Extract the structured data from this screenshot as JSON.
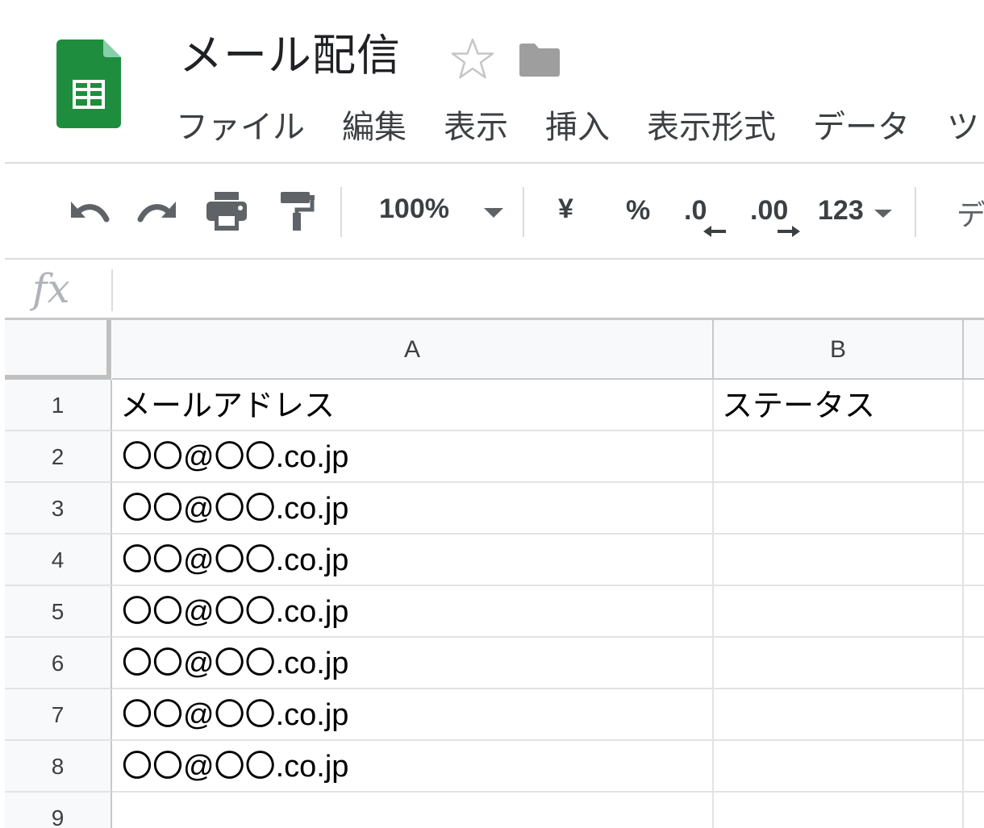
{
  "doc": {
    "title": "メール配信",
    "app_color": "#1e8e3e"
  },
  "menu": [
    "ファイル",
    "編集",
    "表示",
    "挿入",
    "表示形式",
    "データ",
    "ツ"
  ],
  "toolbar": {
    "icons": [
      "undo-icon",
      "redo-icon",
      "print-icon",
      "paint-format-icon"
    ],
    "zoom": "100%",
    "currency": "¥",
    "percent": "%",
    "decrease_decimal": ".0",
    "increase_decimal": ".00",
    "more_formats": "123",
    "font_partial": "デ"
  },
  "formula": {
    "label": "fx",
    "value": ""
  },
  "columns": [
    "A",
    "B"
  ],
  "rows": [
    {
      "num": "1",
      "a": "メールアドレス",
      "b": "ステータス"
    },
    {
      "num": "2",
      "a": "〇〇@〇〇.co.jp",
      "b": ""
    },
    {
      "num": "3",
      "a": "〇〇@〇〇.co.jp",
      "b": ""
    },
    {
      "num": "4",
      "a": "〇〇@〇〇.co.jp",
      "b": ""
    },
    {
      "num": "5",
      "a": "〇〇@〇〇.co.jp",
      "b": ""
    },
    {
      "num": "6",
      "a": "〇〇@〇〇.co.jp",
      "b": ""
    },
    {
      "num": "7",
      "a": "〇〇@〇〇.co.jp",
      "b": ""
    },
    {
      "num": "8",
      "a": "〇〇@〇〇.co.jp",
      "b": ""
    },
    {
      "num": "9",
      "a": "",
      "b": ""
    }
  ]
}
